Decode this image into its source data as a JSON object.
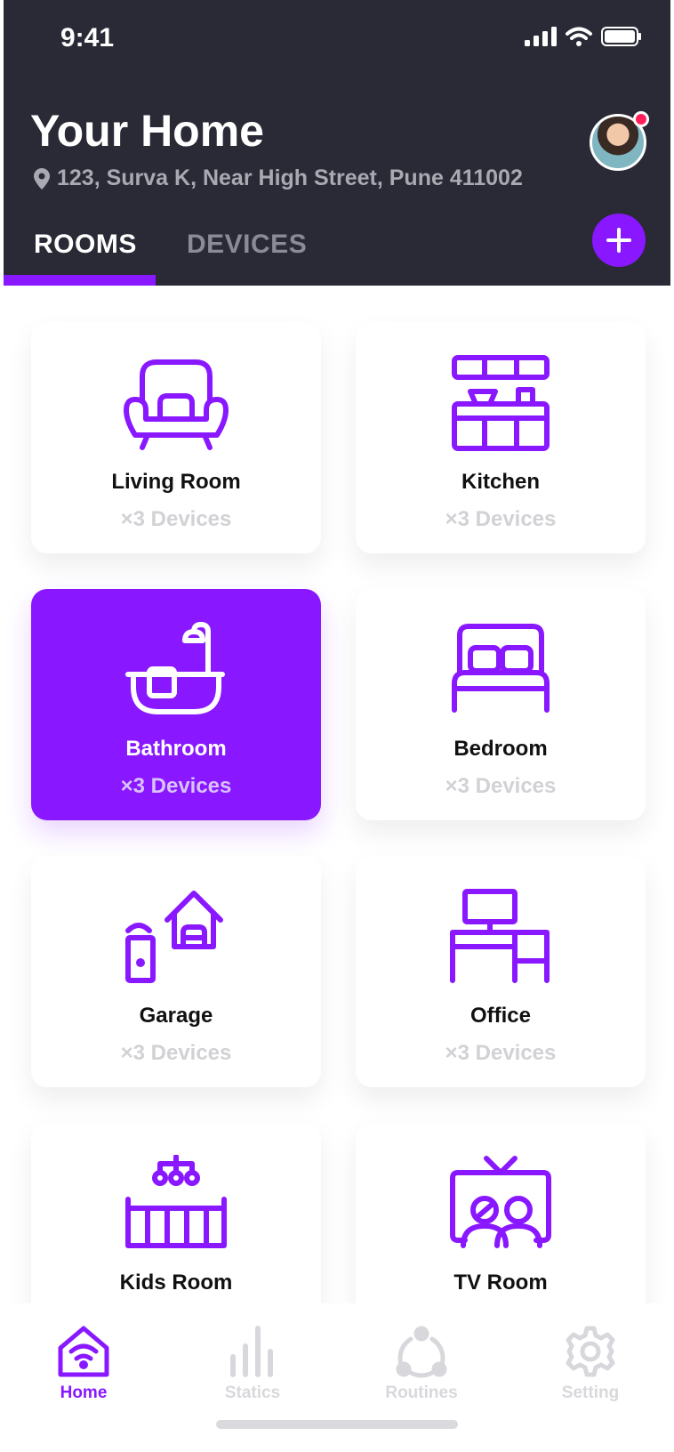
{
  "status_bar": {
    "time": "9:41"
  },
  "header": {
    "title": "Your Home",
    "address": "123, Surva K, Near High Street, Pune 411002"
  },
  "tabs": [
    {
      "label": "ROOMS",
      "active": true
    },
    {
      "label": "DEVICES",
      "active": false
    }
  ],
  "rooms": [
    {
      "name": "Living Room",
      "devices": "×3 Devices",
      "icon": "armchair-icon",
      "active": false
    },
    {
      "name": "Kitchen",
      "devices": "×3 Devices",
      "icon": "kitchen-counter-icon",
      "active": false
    },
    {
      "name": "Bathroom",
      "devices": "×3 Devices",
      "icon": "bathtub-icon",
      "active": true
    },
    {
      "name": "Bedroom",
      "devices": "×3 Devices",
      "icon": "bed-icon",
      "active": false
    },
    {
      "name": "Garage",
      "devices": "×3 Devices",
      "icon": "garage-icon",
      "active": false
    },
    {
      "name": "Office",
      "devices": "×3 Devices",
      "icon": "desk-icon",
      "active": false
    },
    {
      "name": "Kids Room",
      "devices": "",
      "icon": "crib-icon",
      "active": false
    },
    {
      "name": "TV Room",
      "devices": "",
      "icon": "tv-room-icon",
      "active": false
    }
  ],
  "bottom_nav": [
    {
      "label": "Home",
      "icon": "home-wifi-icon",
      "active": true
    },
    {
      "label": "Statics",
      "icon": "bar-chart-icon",
      "active": false
    },
    {
      "label": "Routines",
      "icon": "routines-icon",
      "active": false
    },
    {
      "label": "Setting",
      "icon": "gear-icon",
      "active": false
    }
  ],
  "colors": {
    "accent": "#8917ff",
    "header_bg": "#2a2a36",
    "notification": "#ff1f5a",
    "muted_text": "#d2d2d6"
  }
}
